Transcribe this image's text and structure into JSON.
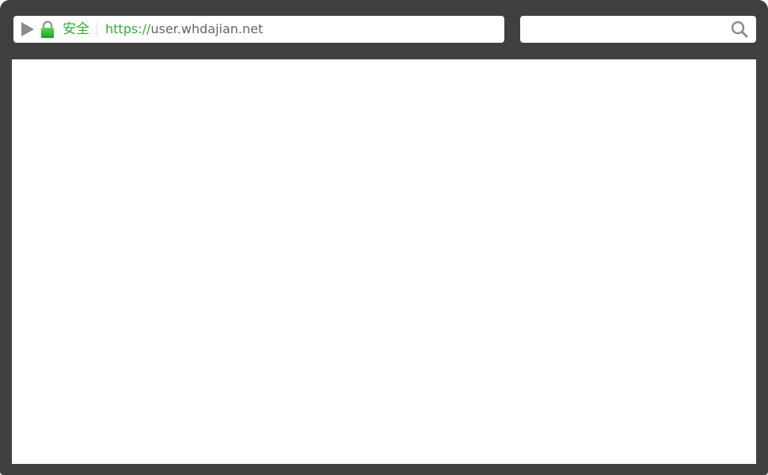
{
  "address_bar": {
    "secure_label": "安全",
    "url_scheme": "https://",
    "url_host": "user.whdajian.net",
    "icons": {
      "play": "play-triangle-icon",
      "lock": "padlock-icon"
    }
  },
  "search": {
    "placeholder": "",
    "icon": "search-icon"
  },
  "colors": {
    "frame": "#404040",
    "secure_green": "#2fb135",
    "url_gray": "#666666",
    "icon_gray": "#8a8a8a"
  }
}
